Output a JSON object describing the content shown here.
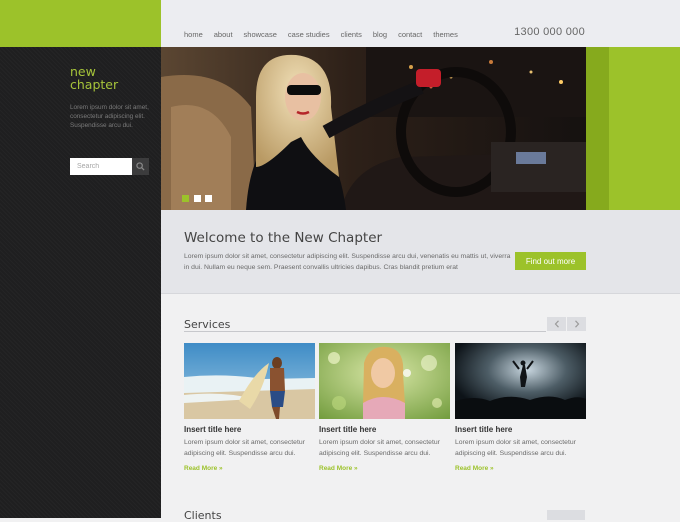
{
  "brand": {
    "line1": "new",
    "line2": "chapter"
  },
  "sidebar": {
    "tagline": "Lorem ipsum dolor sit amet, consectetur adipiscing elit. Suspendisse arcu dui.",
    "search_placeholder": "Search"
  },
  "nav": {
    "items": [
      "home",
      "about",
      "showcase",
      "case studies",
      "clients",
      "blog",
      "contact",
      "themes"
    ],
    "phone": "1300 000 000"
  },
  "welcome": {
    "title": "Welcome to the New Chapter",
    "text": "Lorem ipsum dolor sit amet, consectetur adipiscing elit. Suspendisse arcu dui, venenatis eu mattis ut, viverra in dui. Nullam eu neque sem. Praesent convallis ultricies dapibus. Cras blandit pretium erat",
    "button": "Find out more"
  },
  "services": {
    "title": "Services",
    "cards": [
      {
        "title": "Insert title here",
        "text": "Lorem ipsum dolor sit amet, consectetur adipiscing elit. Suspendisse arcu dui.",
        "link": "Read More »",
        "image": "surfer"
      },
      {
        "title": "Insert title here",
        "text": "Lorem ipsum dolor sit amet, consectetur adipiscing elit. Suspendisse arcu dui.",
        "link": "Read More »",
        "image": "woman-dandelion"
      },
      {
        "title": "Insert title here",
        "text": "Lorem ipsum dolor sit amet, consectetur adipiscing elit. Suspendisse arcu dui.",
        "link": "Read More »",
        "image": "concert"
      }
    ]
  },
  "clients": {
    "title": "Clients"
  },
  "colors": {
    "accent": "#9cc22a",
    "sidebar": "#1f1f20",
    "topbar": "#ecedf1"
  },
  "icons": {
    "search": "search-icon",
    "prev": "chevron-left-icon",
    "next": "chevron-right-icon"
  }
}
